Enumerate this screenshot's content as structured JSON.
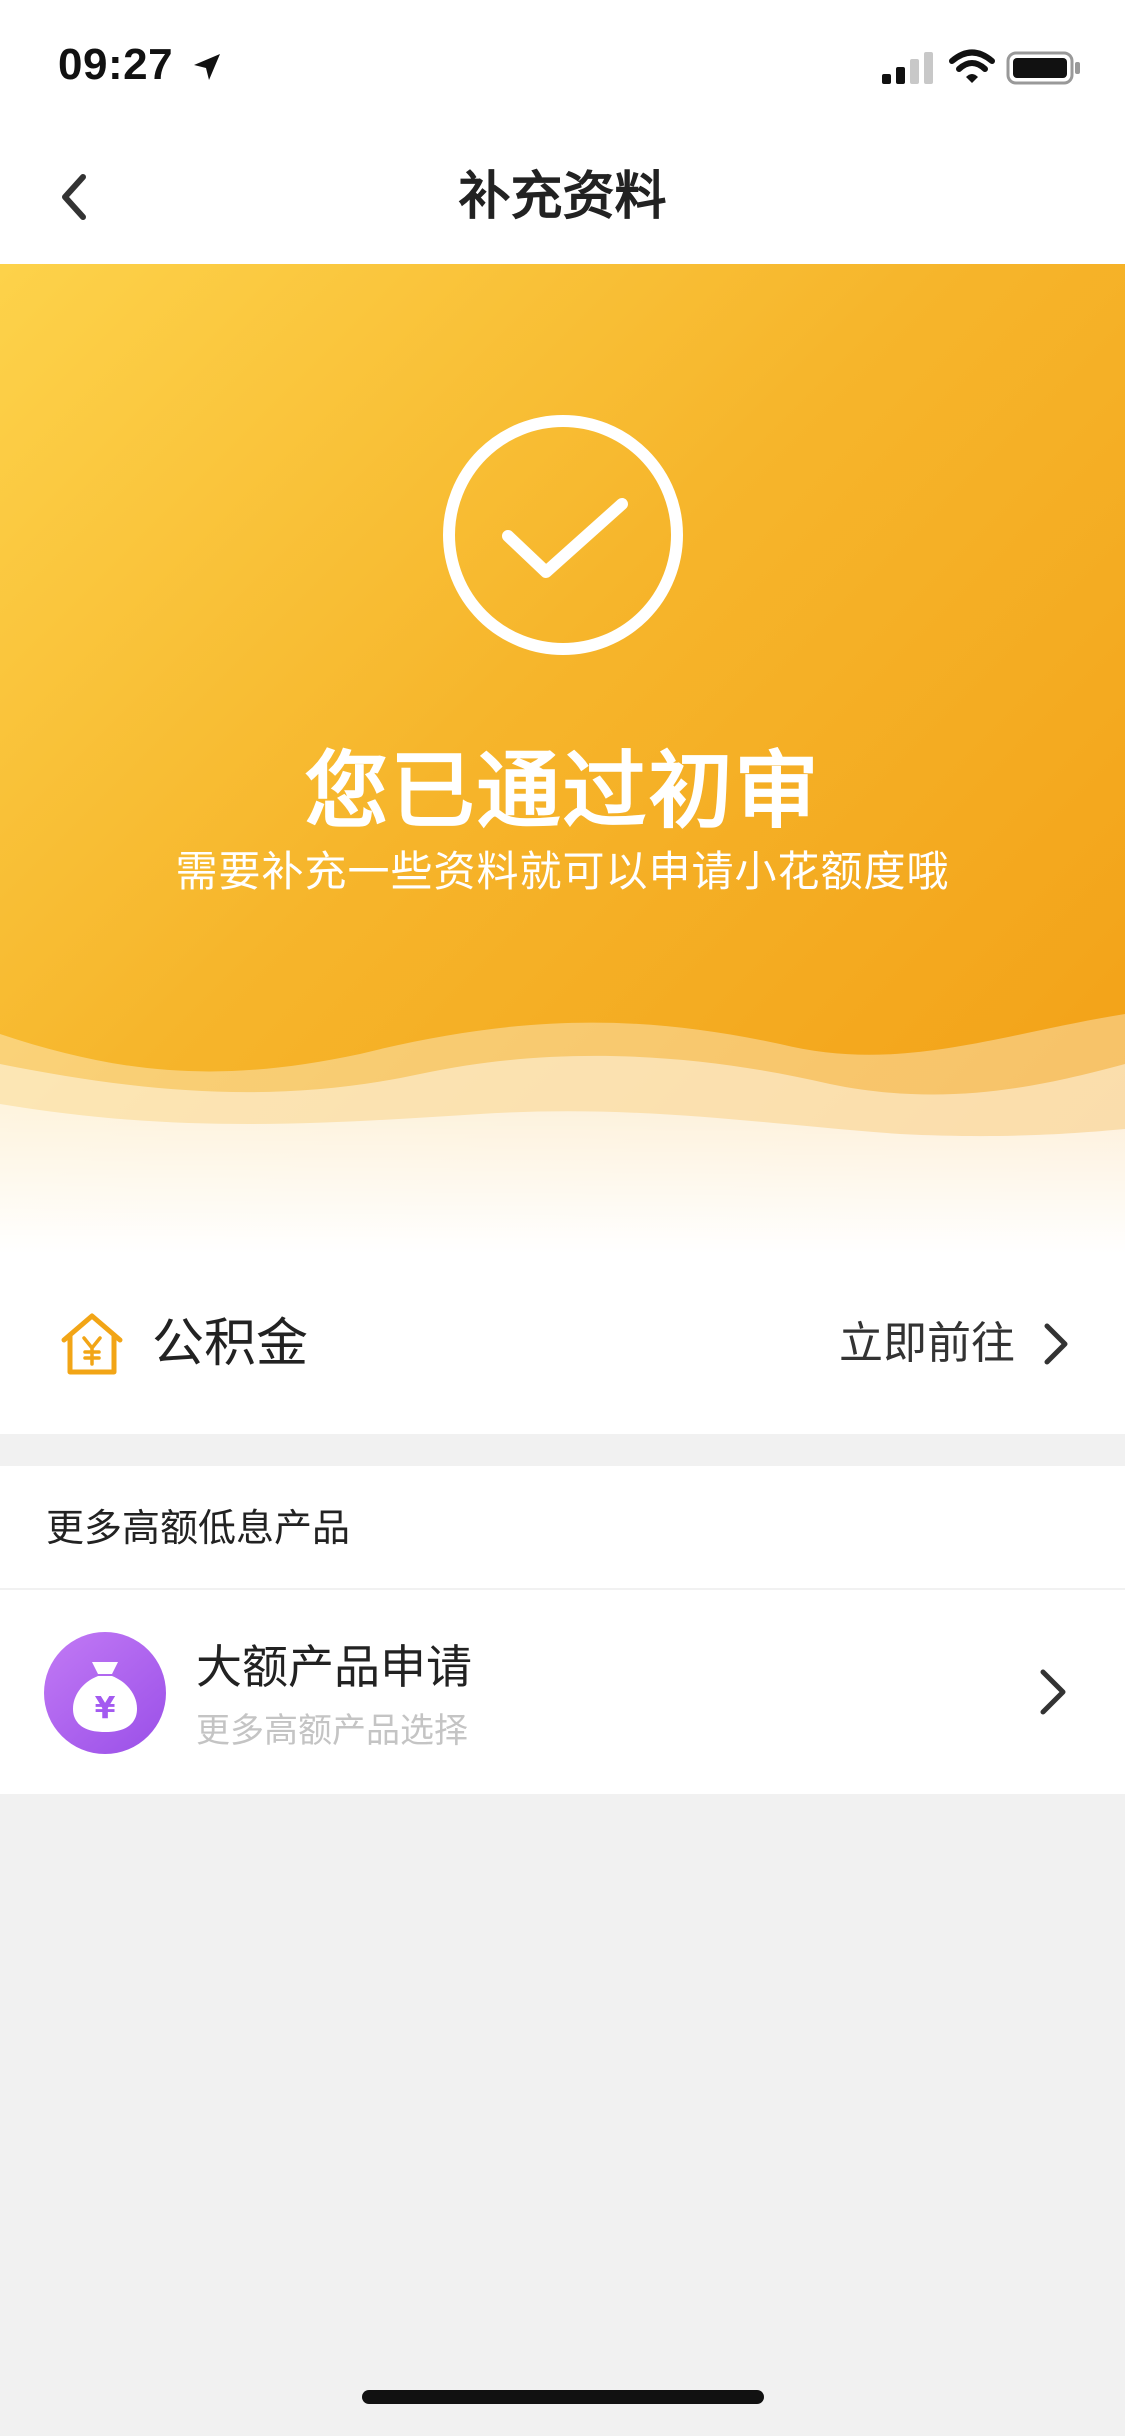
{
  "status_bar": {
    "time": "09:27"
  },
  "nav": {
    "title": "补充资料"
  },
  "hero": {
    "title": "您已通过初审",
    "subtitle": "需要补充一些资料就可以申请小花额度哦"
  },
  "fund": {
    "label": "公积金",
    "action": "立即前往"
  },
  "section": {
    "title": "更多高额低息产品"
  },
  "product": {
    "title": "大额产品申请",
    "subtitle": "更多高额产品选择",
    "icon_symbol": "¥"
  },
  "colors": {
    "hero_start": "#fdd24a",
    "hero_end": "#f29f15",
    "accent_orange": "#f2a516",
    "purple": "#a35af0",
    "background": "#f1f1f1"
  },
  "icons": {
    "back": "chevron-left-icon",
    "check": "check-circle-icon",
    "house": "house-yen-icon",
    "money_bag": "money-bag-icon",
    "chevron": "chevron-right-icon"
  }
}
